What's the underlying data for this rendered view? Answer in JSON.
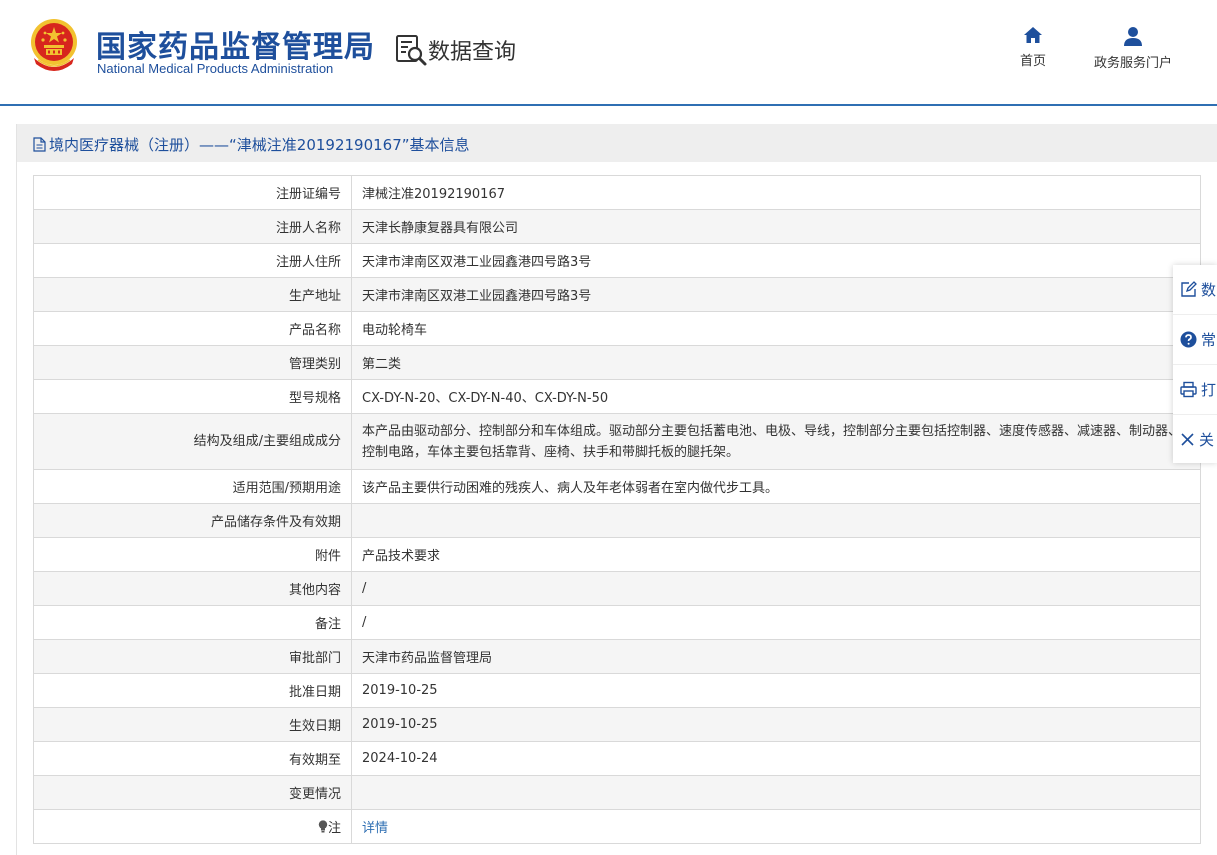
{
  "header": {
    "brand_cn": "国家药品监督管理局",
    "brand_en": "National Medical Products Administration",
    "query_title": "数据查询",
    "nav": {
      "home": "首页",
      "portal": "政务服务门户"
    }
  },
  "panel": {
    "title": "境内医疗器械（注册）——“津械注准20192190167”基本信息"
  },
  "rows": [
    {
      "label": "注册证编号",
      "value": "津械注准20192190167"
    },
    {
      "label": "注册人名称",
      "value": "天津长静康复器具有限公司"
    },
    {
      "label": "注册人住所",
      "value": "天津市津南区双港工业园鑫港四号路3号"
    },
    {
      "label": "生产地址",
      "value": "天津市津南区双港工业园鑫港四号路3号"
    },
    {
      "label": "产品名称",
      "value": "电动轮椅车"
    },
    {
      "label": "管理类别",
      "value": "第二类"
    },
    {
      "label": "型号规格",
      "value": "CX-DY-N-20、CX-DY-N-40、CX-DY-N-50"
    },
    {
      "label": "结构及组成/主要组成成分",
      "value": "本产品由驱动部分、控制部分和车体组成。驱动部分主要包括蓄电池、电极、导线，控制部分主要包括控制器、速度传感器、减速器、制动器、控制电路，车体主要包括靠背、座椅、扶手和带脚托板的腿托架。"
    },
    {
      "label": "适用范围/预期用途",
      "value": "该产品主要供行动困难的残疾人、病人及年老体弱者在室内做代步工具。"
    },
    {
      "label": "产品储存条件及有效期",
      "value": ""
    },
    {
      "label": "附件",
      "value": "产品技术要求"
    },
    {
      "label": "其他内容",
      "value": "/"
    },
    {
      "label": "备注",
      "value": "/"
    },
    {
      "label": "审批部门",
      "value": "天津市药品监督管理局"
    },
    {
      "label": "批准日期",
      "value": "2019-10-25"
    },
    {
      "label": "生效日期",
      "value": "2019-10-25"
    },
    {
      "label": "有效期至",
      "value": "2024-10-24"
    },
    {
      "label": "变更情况",
      "value": ""
    },
    {
      "label": "注",
      "value": "详情"
    }
  ],
  "side_toolbar": {
    "items": [
      {
        "label": "数",
        "icon": "edit-icon"
      },
      {
        "label": "常",
        "icon": "help-circle-icon"
      },
      {
        "label": "打",
        "icon": "printer-icon"
      },
      {
        "label": "关",
        "icon": "close-icon"
      }
    ]
  },
  "colors": {
    "brand": "#1e4f9c",
    "accent_line": "#2f6fb3",
    "emblem_red": "#d7261d",
    "emblem_gold": "#f2c230"
  },
  "icons": {
    "note": "lightbulb-icon",
    "home": "home-icon",
    "portal": "user-icon",
    "query": "search-doc-icon",
    "title": "document-icon"
  }
}
